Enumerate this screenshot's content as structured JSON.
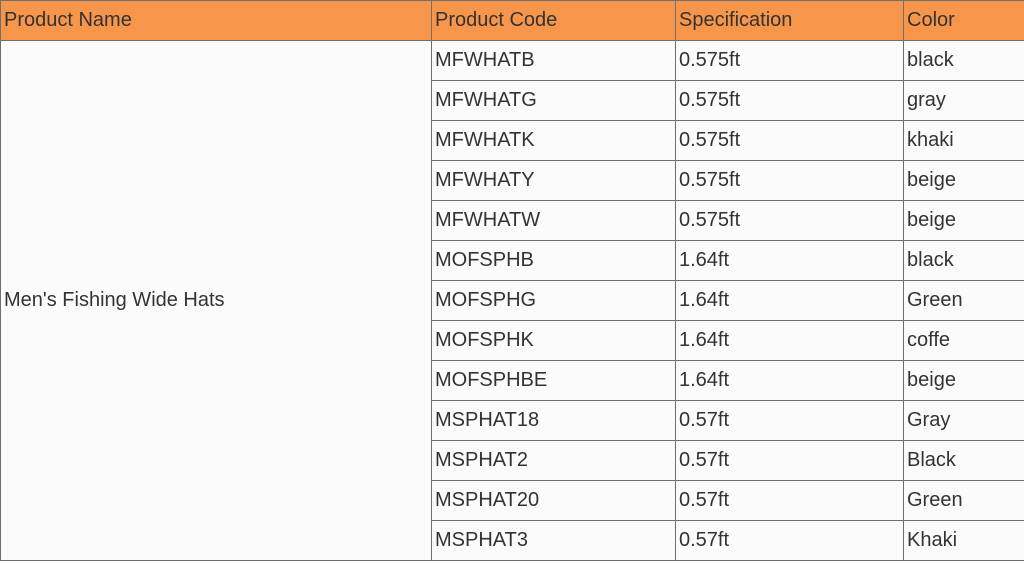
{
  "table": {
    "headers": [
      "Product Name",
      "Product Code",
      "Specification",
      "Color"
    ],
    "product_name": "Men's Fishing Wide Hats",
    "rows": [
      {
        "code": "MFWHATB",
        "spec": "0.575ft",
        "color": "black"
      },
      {
        "code": "MFWHATG",
        "spec": "0.575ft",
        "color": "gray"
      },
      {
        "code": "MFWHATK",
        "spec": "0.575ft",
        "color": "khaki"
      },
      {
        "code": "MFWHATY",
        "spec": "0.575ft",
        "color": "beige"
      },
      {
        "code": "MFWHATW",
        "spec": "0.575ft",
        "color": "beige"
      },
      {
        "code": "MOFSPHB",
        "spec": "1.64ft",
        "color": "black"
      },
      {
        "code": "MOFSPHG",
        "spec": "1.64ft",
        "color": "Green"
      },
      {
        "code": "MOFSPHK",
        "spec": "1.64ft",
        "color": "coffe"
      },
      {
        "code": "MOFSPHBE",
        "spec": "1.64ft",
        "color": "beige"
      },
      {
        "code": "MSPHAT18",
        "spec": "0.57ft",
        "color": "Gray"
      },
      {
        "code": "MSPHAT2",
        "spec": "0.57ft",
        "color": "Black"
      },
      {
        "code": "MSPHAT20",
        "spec": "0.57ft",
        "color": "Green"
      },
      {
        "code": "MSPHAT3",
        "spec": "0.57ft",
        "color": "Khaki"
      }
    ]
  },
  "colors": {
    "header_background": "#f7954b",
    "border": "#6f6f6f",
    "text": "#333333"
  }
}
